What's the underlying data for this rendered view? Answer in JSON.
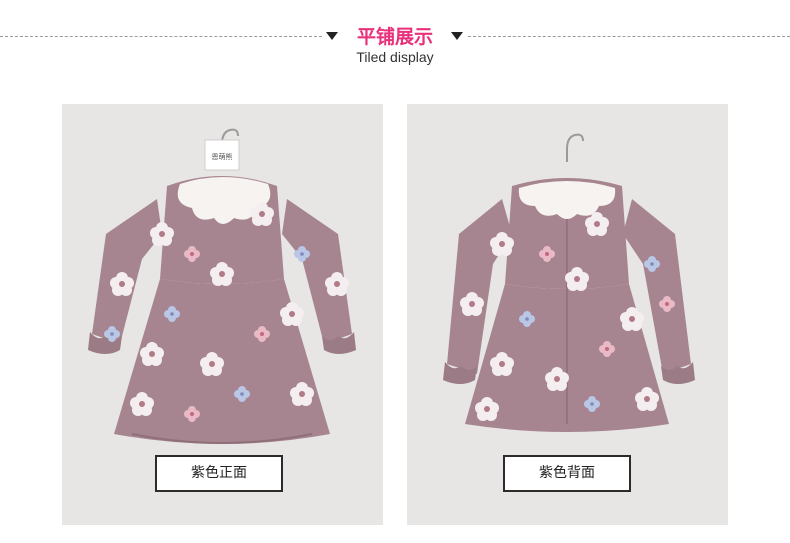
{
  "section": {
    "title_cn": "平铺展示",
    "title_en": "Tiled display",
    "accent_color": "#e8317a"
  },
  "photos": [
    {
      "caption": "紫色正面",
      "view": "front",
      "hanger_tag": "恩萌熊"
    },
    {
      "caption": "紫色背面",
      "view": "back"
    }
  ],
  "colors": {
    "fabric": "#a68590",
    "fabric_dark": "#8e6f7a",
    "collar": "#f7f3f1",
    "flower_white": "#f5eef0",
    "flower_pink": "#e9b9c6",
    "flower_blue": "#b9c6e6",
    "backdrop": "#e7e6e4"
  }
}
